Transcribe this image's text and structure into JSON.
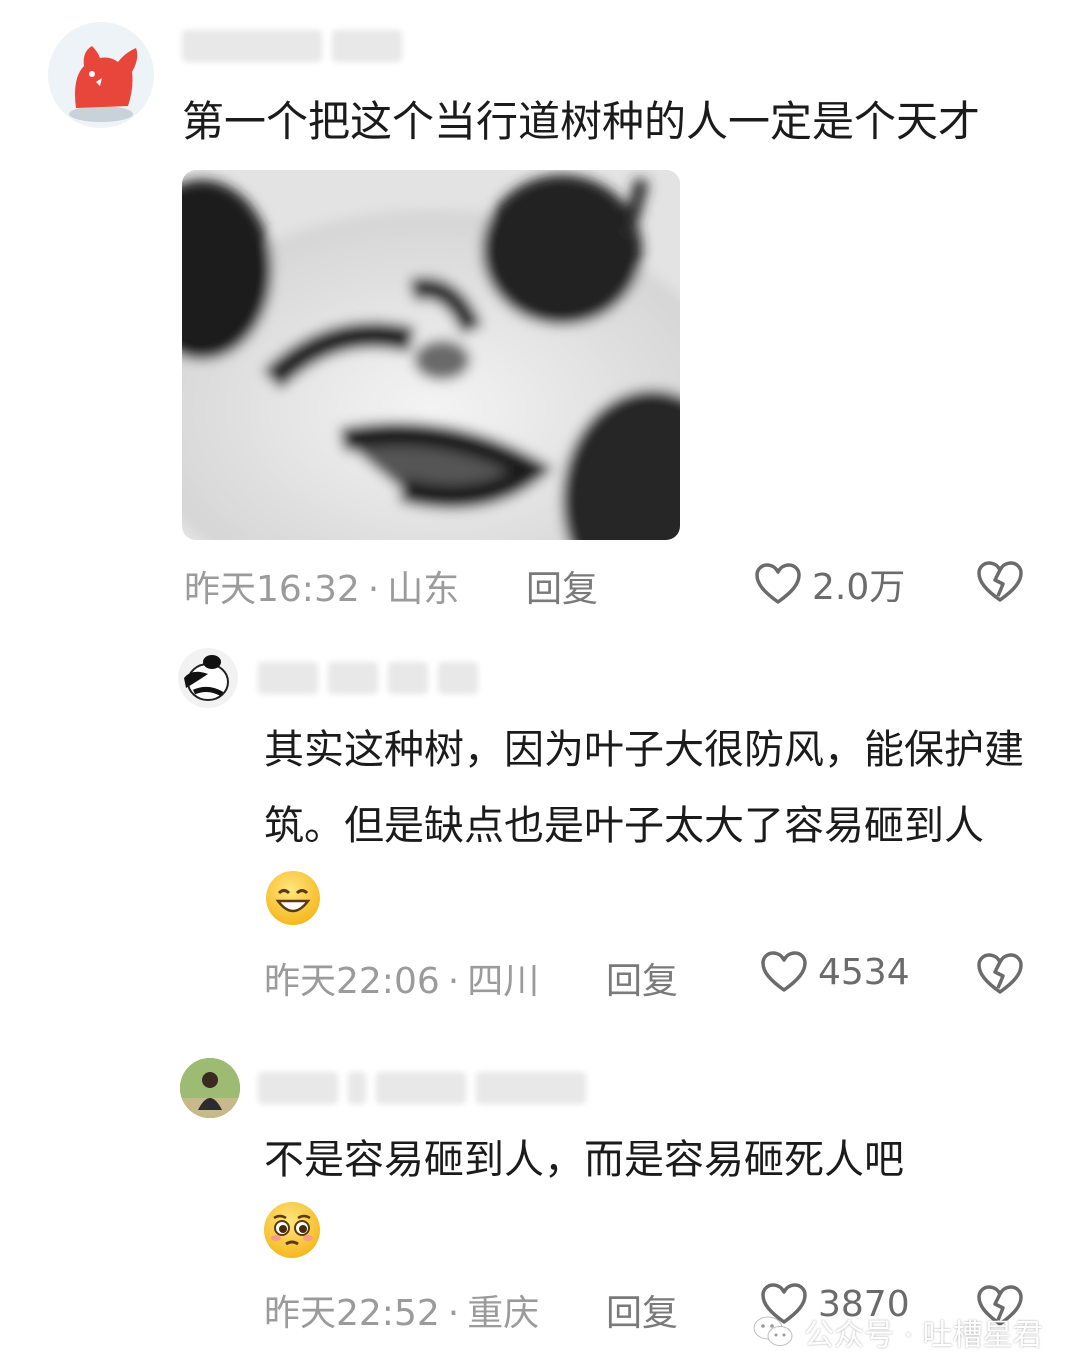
{
  "comments": [
    {
      "text": "第一个把这个当行道树种的人一定是个天才",
      "time": "昨天16:32",
      "separator": "·",
      "location": "山东",
      "reply_label": "回复",
      "likes": "2.0万"
    },
    {
      "text": "其实这种树，因为叶子大很防风，能保护建筑。但是缺点也是叶子太大了容易砸到人",
      "time": "昨天22:06",
      "separator": "·",
      "location": "四川",
      "reply_label": "回复",
      "likes": "4534"
    },
    {
      "text": "不是容易砸到人，而是容易砸死人吧",
      "time": "昨天22:52",
      "separator": "·",
      "location": "重庆",
      "reply_label": "回复",
      "likes": "3870"
    }
  ],
  "watermark": {
    "label": "公众号 · 吐槽星君"
  },
  "icons": {
    "like": "heart-outline-icon",
    "dislike": "broken-heart-icon",
    "watermark": "wechat-icon"
  },
  "colors": {
    "meta_text": "#9b9b9b",
    "avatar_red": "#e8463b"
  }
}
